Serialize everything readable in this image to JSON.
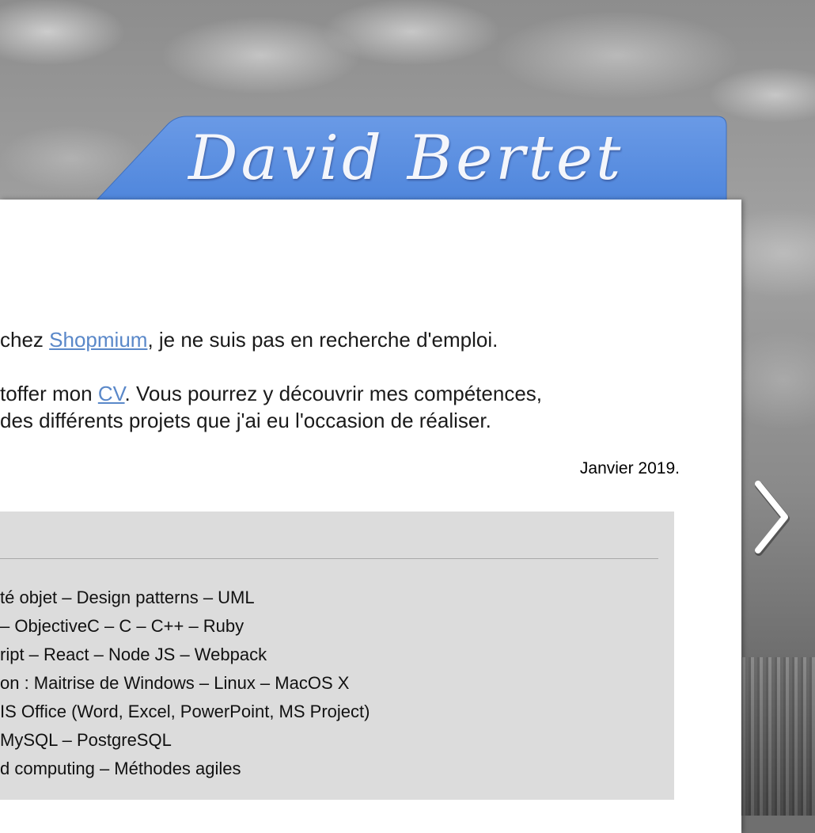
{
  "site": {
    "name": "David Bertet"
  },
  "intro": {
    "line1_before": "chez ",
    "line1_link": "Shopmium",
    "line1_after": ", je ne suis pas en recherche d'emploi.",
    "line2_before": "toffer mon ",
    "line2_link": "CV",
    "line2_after": ". Vous pourrez y découvrir mes compétences,",
    "line3": "des différents projets que j'ai eu l'occasion de réaliser.",
    "date": "Janvier 2019."
  },
  "skills": {
    "items": [
      "té objet – Design patterns – UML",
      "– ObjectiveC – C – C++ – Ruby",
      "ript – React – Node JS – Webpack",
      "on : Maitrise de Windows – Linux – MacOS X",
      "IS Office (Word, Excel, PowerPoint, MS Project)",
      "MySQL – PostgreSQL",
      "d computing – Méthodes agiles"
    ]
  },
  "navigation": {
    "next_icon": "chevron-right-icon"
  },
  "colors": {
    "tab_blue": "#5b8fe0",
    "link_blue": "#5a88c9",
    "panel_grey": "#dcdcdc"
  }
}
